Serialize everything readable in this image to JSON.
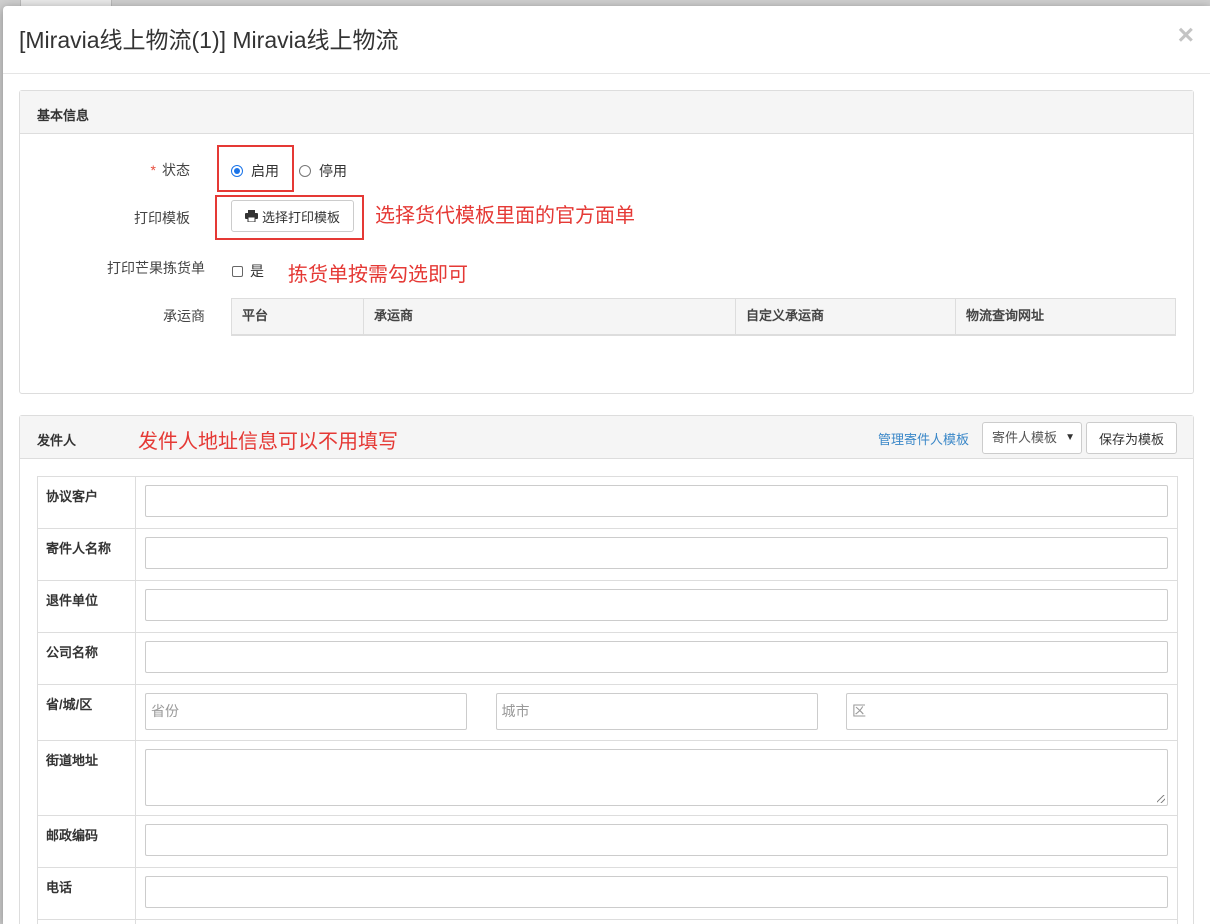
{
  "modal": {
    "title": "[Miravia线上物流(1)] Miravia线上物流",
    "close_label": "×"
  },
  "basic": {
    "panel_title": "基本信息",
    "status_required_mark": "*",
    "status_label": "状态",
    "status_options": [
      "启用",
      "停用"
    ],
    "status_selected": "启用",
    "print_template_label": "打印模板",
    "select_template_button": "选择打印模板",
    "print_template_note": "选择货代模板里面的官方面单",
    "mango_pick_label": "打印芒果拣货单",
    "mango_pick_checkbox_label": "是",
    "mango_pick_note": "拣货单按需勾选即可",
    "carrier_label": "承运商",
    "carrier_columns": [
      "平台",
      "承运商",
      "自定义承运商",
      "物流查询网址"
    ]
  },
  "sender": {
    "panel_title": "发件人",
    "panel_note": "发件人地址信息可以不用填写",
    "manage_link": "管理寄件人模板",
    "template_select_value": "寄件人模板",
    "save_template_button": "保存为模板",
    "rows": {
      "agreement_customer": "协议客户",
      "sender_name": "寄件人名称",
      "return_unit": "退件单位",
      "company_name": "公司名称",
      "province_city_district": "省/城/区",
      "street_address": "街道地址",
      "postal_code": "邮政编码",
      "phone": "电话"
    },
    "placeholders": {
      "province": "省份",
      "city": "城市",
      "district": "区"
    }
  }
}
